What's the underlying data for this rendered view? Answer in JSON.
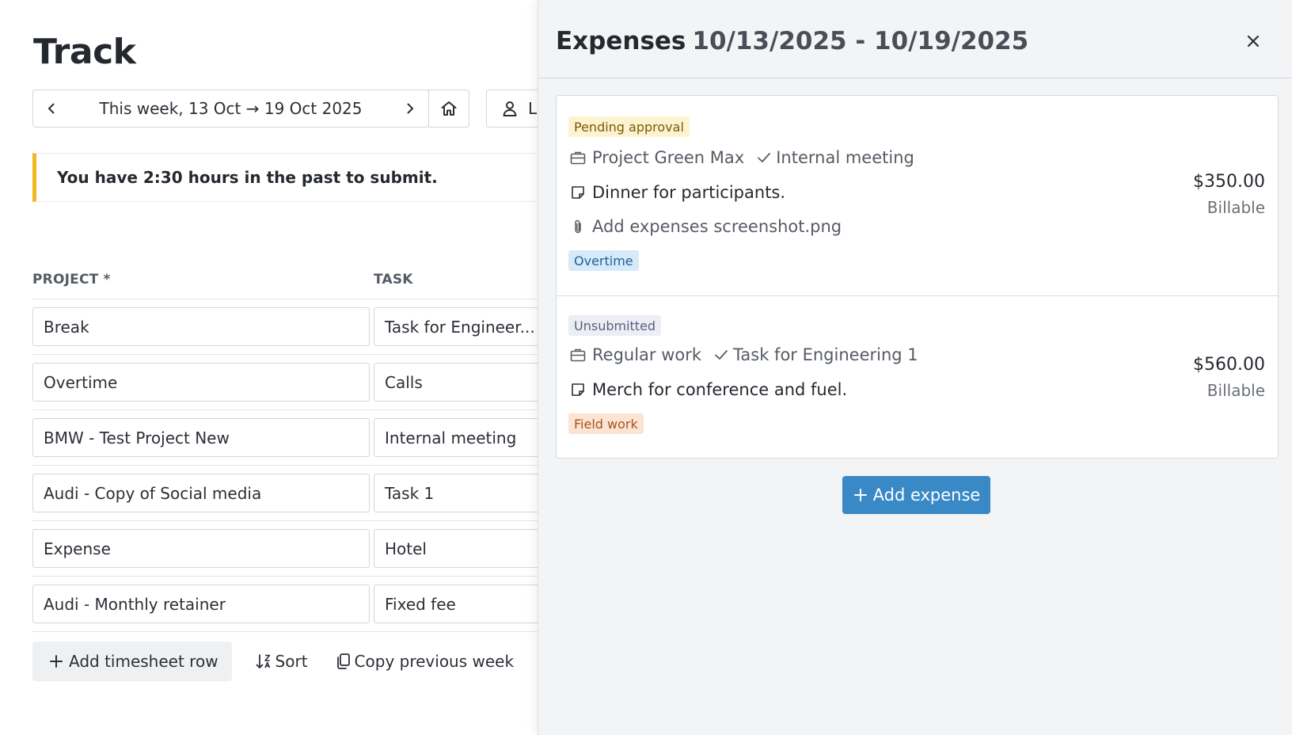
{
  "track": {
    "title": "Track",
    "week_label": "This week, 13 Oct → 19 Oct 2025",
    "user_initial": "L",
    "alert": "You have 2:30 hours in the past to submit.",
    "columns": {
      "project": "PROJECT *",
      "task": "TASK"
    },
    "rows": [
      {
        "project": "Break",
        "task": "Task for Engineer..."
      },
      {
        "project": "Overtime",
        "task": "Calls"
      },
      {
        "project": "BMW - Test Project New",
        "task": "Internal meeting"
      },
      {
        "project": "Audi - Copy of Social media",
        "task": "Task 1"
      },
      {
        "project": "Expense",
        "task": "Hotel"
      },
      {
        "project": "Audi - Monthly retainer",
        "task": "Fixed fee"
      }
    ],
    "actions": {
      "add_row": "Add timesheet row",
      "sort": "Sort",
      "copy": "Copy previous week"
    }
  },
  "panel": {
    "title": "Expenses",
    "range": "10/13/2025 - 10/19/2025",
    "expenses": [
      {
        "status": "Pending approval",
        "project": "Project Green Max",
        "task": "Internal meeting",
        "note": "Dinner for participants.",
        "attachment": "Add expenses screenshot.png",
        "tag": "Overtime",
        "amount": "$350.00",
        "billable": "Billable"
      },
      {
        "status": "Unsubmitted",
        "project": "Regular work",
        "task": "Task for Engineering 1",
        "note": "Merch for conference and fuel.",
        "tag": "Field work",
        "amount": "$560.00",
        "billable": "Billable"
      }
    ],
    "add_expense": "Add expense"
  },
  "colors": {
    "accent_button": "#3889c6",
    "alert_bar": "#f2b824",
    "panel_bg": "#f3f4f6"
  },
  "icons": [
    "chevron-left-icon",
    "chevron-right-icon",
    "home-icon",
    "user-icon",
    "plus-icon",
    "sort-icon",
    "copy-icon",
    "close-icon",
    "briefcase-icon",
    "check-icon",
    "note-icon",
    "paperclip-icon"
  ]
}
